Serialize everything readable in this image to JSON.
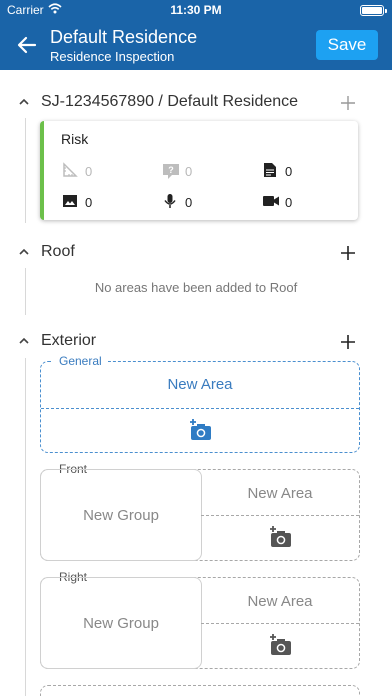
{
  "status_bar": {
    "carrier": "Carrier",
    "time": "11:30 PM"
  },
  "header": {
    "title": "Default Residence",
    "subtitle": "Residence  Inspection",
    "save_label": "Save",
    "icons": {
      "back": "arrow-left-icon"
    }
  },
  "colors": {
    "header_bg": "#1a64a8",
    "save_button": "#1da1f2",
    "risk_accent": "#6cc04a",
    "general_border": "#4a8fcf"
  },
  "sections": [
    {
      "id": "job",
      "title": "SJ-1234567890 / Default Residence",
      "card": {
        "title": "Risk",
        "stats": [
          {
            "icon": "ruler-icon",
            "count": "0",
            "muted": true
          },
          {
            "icon": "question-icon",
            "count": "0",
            "muted": true
          },
          {
            "icon": "document-icon",
            "count": "0",
            "muted": false
          },
          {
            "icon": "image-icon",
            "count": "0",
            "muted": false
          },
          {
            "icon": "microphone-icon",
            "count": "0",
            "muted": false
          },
          {
            "icon": "video-icon",
            "count": "0",
            "muted": false
          }
        ]
      }
    },
    {
      "id": "roof",
      "title": "Roof",
      "empty_text": "No areas have been added to Roof"
    },
    {
      "id": "exterior",
      "title": "Exterior",
      "groups": [
        {
          "label": "General",
          "area_label": "New Area",
          "icon": "add-photo-icon"
        },
        {
          "label": "Front",
          "group_label": "New Group",
          "area_label": "New Area",
          "icon": "add-photo-icon"
        },
        {
          "label": "Right",
          "group_label": "New Group",
          "area_label": "New Area",
          "icon": "add-photo-icon"
        }
      ]
    }
  ]
}
